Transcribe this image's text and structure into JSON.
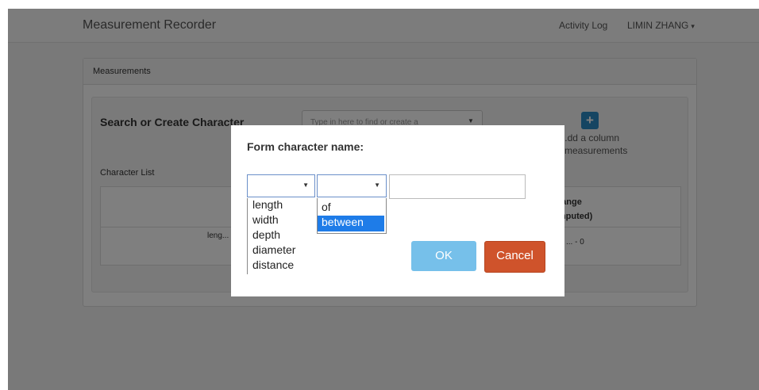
{
  "navbar": {
    "app_title": "Measurement Recorder",
    "activity_log": "Activity Log",
    "user_name": "LIMIN ZHANG",
    "user_caret": "▾"
  },
  "panel": {
    "title": "Measurements",
    "search_heading": "Search or Create Character",
    "search_placeholder": "Type in here to find or create a",
    "add_column_icon": "+",
    "add_column_label_line1": "..dd a column",
    "add_column_label_line2": "... measurements",
    "character_list_label": "Character List",
    "range_header_line1": "... Range",
    "range_header_line2": "...omputed)",
    "row_name": "leng...",
    "row_range": "... - 0"
  },
  "modal": {
    "title": "Form character name:",
    "modifier_value": "",
    "preposition_value": "",
    "name_input_value": "",
    "character_options": [
      "length",
      "width",
      "depth",
      "diameter",
      "distance"
    ],
    "preposition_options": [
      "of",
      "between"
    ],
    "preposition_selected": "between",
    "ok_label": "OK",
    "cancel_label": "Cancel"
  },
  "colors": {
    "ok_button": "#76c0ea",
    "cancel_button": "#cf532b",
    "add_button": "#2a8bc5",
    "selected_option": "#1e7ce8"
  },
  "icons": {
    "dropdown_arrow": "caret-down-icon",
    "add_column": "plus-icon"
  }
}
